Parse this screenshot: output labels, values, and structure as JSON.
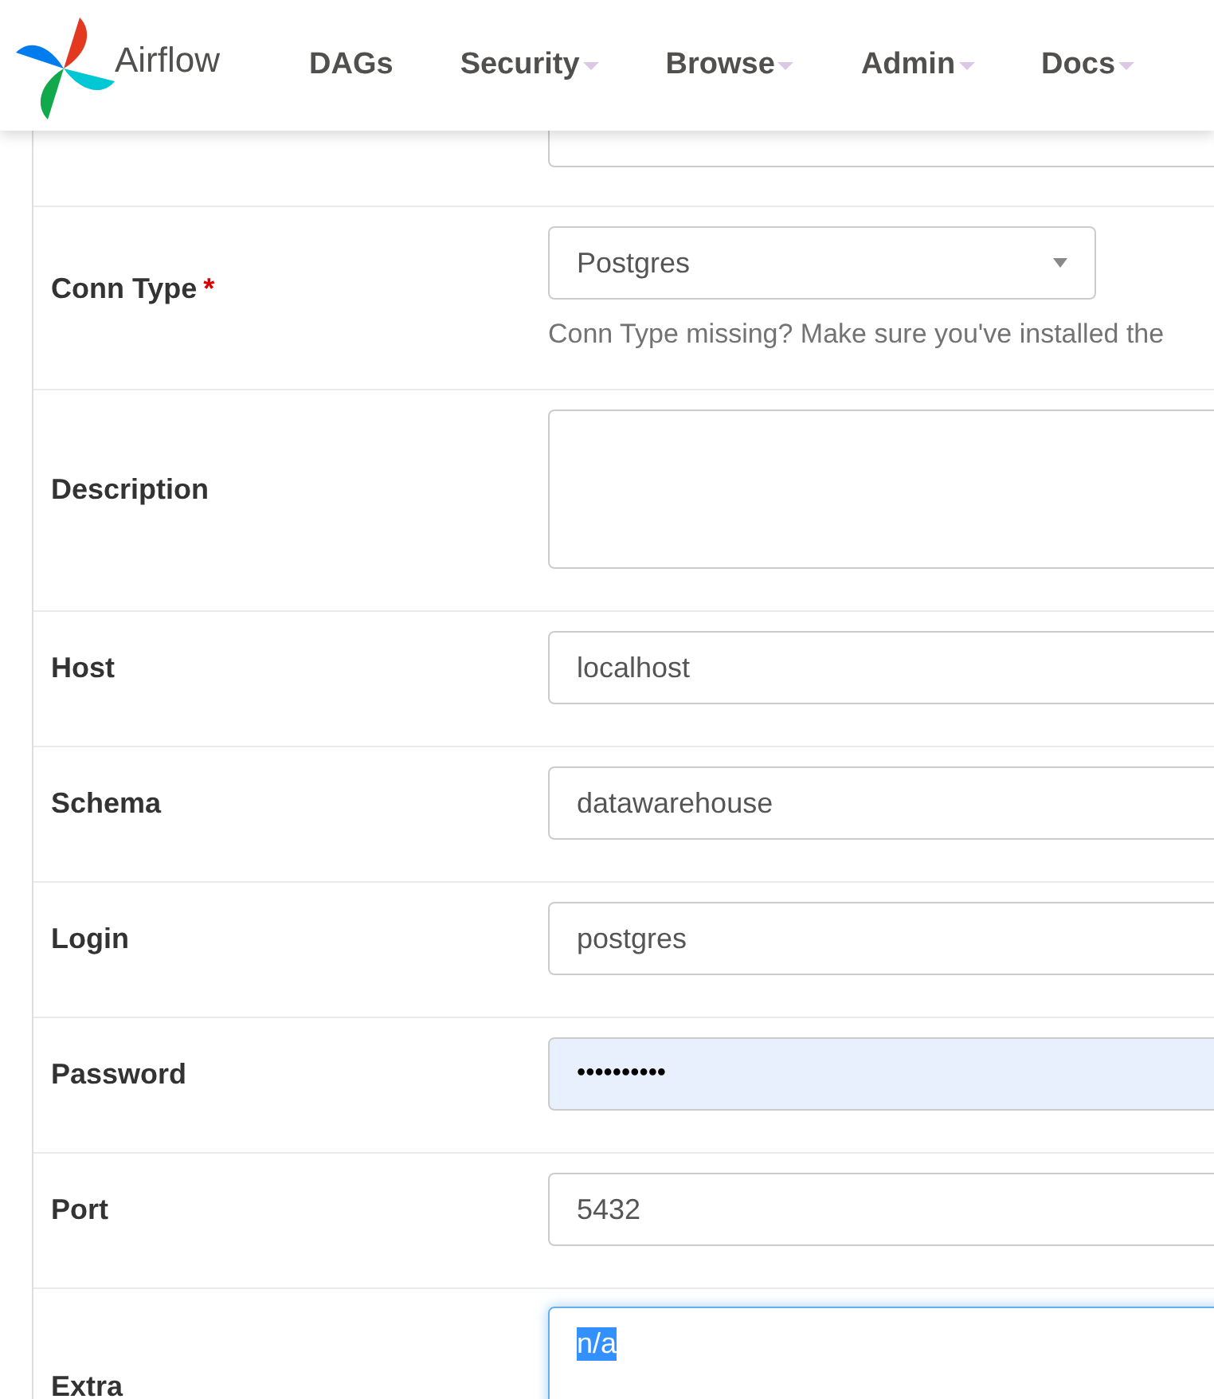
{
  "navbar": {
    "brand": "Airflow",
    "items": [
      {
        "label": "DAGs",
        "has_dropdown": false
      },
      {
        "label": "Security",
        "has_dropdown": true
      },
      {
        "label": "Browse",
        "has_dropdown": true
      },
      {
        "label": "Admin",
        "has_dropdown": true
      },
      {
        "label": "Docs",
        "has_dropdown": true
      }
    ]
  },
  "form": {
    "fields": [
      {
        "kind": "covered"
      },
      {
        "label": "Conn Type",
        "required_mark": "*",
        "kind": "select",
        "value": "Postgres",
        "help": "Conn Type missing? Make sure you've installed the"
      },
      {
        "label": "Description",
        "kind": "textarea"
      },
      {
        "label": "Host",
        "kind": "text",
        "value": "localhost"
      },
      {
        "label": "Schema",
        "kind": "text",
        "value": "datawarehouse"
      },
      {
        "label": "Login",
        "kind": "text",
        "value": "postgres"
      },
      {
        "label": "Password",
        "kind": "password",
        "value": "••••••••••",
        "autofilled": true
      },
      {
        "label": "Port",
        "kind": "text",
        "value": "5432"
      },
      {
        "label": "Extra",
        "kind": "textarea",
        "value": "n/a",
        "focused": true,
        "text_selected": true
      }
    ]
  }
}
